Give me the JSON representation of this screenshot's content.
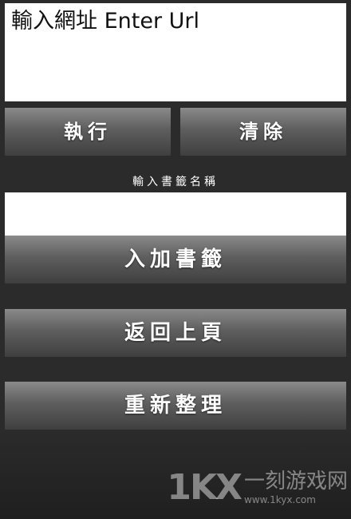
{
  "url_field": {
    "placeholder": "輸入網址 Enter Url"
  },
  "buttons": {
    "execute": "執行",
    "clear": "清除",
    "add_bookmark": "入加書籤",
    "back": "返回上頁",
    "refresh": "重新整理"
  },
  "bookmark": {
    "label": "輸入書籤名稱",
    "value": ""
  },
  "watermark": {
    "logo": "1KX",
    "text": "一刻游戏网",
    "url": "www.1kyx.com"
  }
}
